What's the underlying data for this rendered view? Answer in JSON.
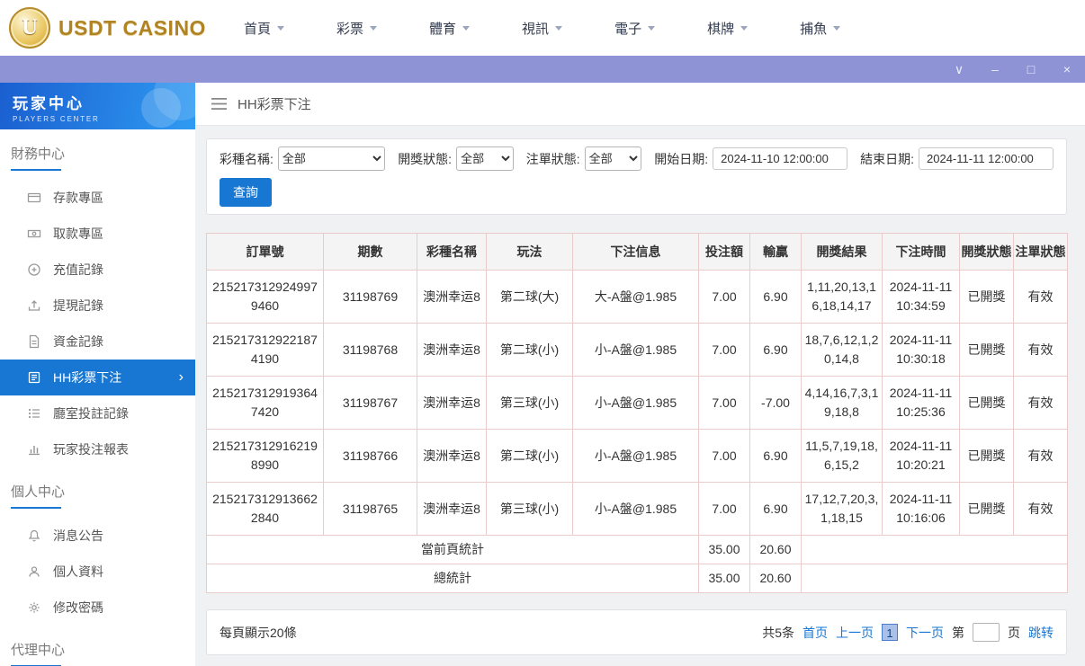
{
  "header": {
    "logo_badge": "U",
    "logo_text": "USDT CASINO",
    "nav": [
      {
        "label": "首頁"
      },
      {
        "label": "彩票"
      },
      {
        "label": "體育"
      },
      {
        "label": "視訊"
      },
      {
        "label": "電子"
      },
      {
        "label": "棋牌"
      },
      {
        "label": "捕魚"
      }
    ]
  },
  "titlebar": {
    "chevron": "∨",
    "minimize": "–",
    "maximize": "□",
    "close": "×"
  },
  "sidebar": {
    "title": "玩家中心",
    "subtitle": "PLAYERS CENTER",
    "active_chevron": "›",
    "sections": [
      {
        "heading": "財務中心",
        "items": [
          {
            "label": "存款專區",
            "icon": "deposit-card-icon"
          },
          {
            "label": "取款專區",
            "icon": "withdraw-cash-icon"
          },
          {
            "label": "充值記錄",
            "icon": "recharge-record-icon"
          },
          {
            "label": "提現記錄",
            "icon": "cashout-record-icon"
          },
          {
            "label": "資金記錄",
            "icon": "funds-record-icon"
          },
          {
            "label": "HH彩票下注",
            "icon": "lottery-bet-icon",
            "active": true
          },
          {
            "label": "廳室投註記錄",
            "icon": "room-bet-record-icon"
          },
          {
            "label": "玩家投注報表",
            "icon": "player-report-icon"
          }
        ]
      },
      {
        "heading": "個人中心",
        "items": [
          {
            "label": "消息公告",
            "icon": "bell-icon"
          },
          {
            "label": "個人資料",
            "icon": "user-icon"
          },
          {
            "label": "修改密碼",
            "icon": "gear-icon"
          }
        ]
      },
      {
        "heading": "代理中心",
        "items": []
      }
    ]
  },
  "breadcrumb": {
    "title": "HH彩票下注"
  },
  "filters": {
    "lottery": {
      "label": "彩種名稱:",
      "value": "全部"
    },
    "draw_status": {
      "label": "開獎狀態:",
      "value": "全部"
    },
    "order_status": {
      "label": "注單狀態:",
      "value": "全部"
    },
    "start_date": {
      "label": "開始日期:",
      "value": "2024-11-10 12:00:00"
    },
    "end_date": {
      "label": "結束日期:",
      "value": "2024-11-11 12:00:00"
    },
    "search_label": "查詢"
  },
  "table": {
    "headers": [
      "訂單號",
      "期數",
      "彩種名稱",
      "玩法",
      "下注信息",
      "投注額",
      "輸贏",
      "開獎結果",
      "下注時間",
      "開獎狀態",
      "注單狀態"
    ],
    "rows": [
      {
        "order": "2152173129249979460",
        "period": "31198769",
        "lottery": "澳洲幸运8",
        "play": "第二球(大)",
        "bet": "大-A盤@1.985",
        "amount": "7.00",
        "win": "6.90",
        "result": "1,11,20,13,16,18,14,17",
        "time": "2024-11-11 10:34:59",
        "draw_status": "已開獎",
        "order_status": "有效"
      },
      {
        "order": "2152173129221874190",
        "period": "31198768",
        "lottery": "澳洲幸运8",
        "play": "第二球(小)",
        "bet": "小-A盤@1.985",
        "amount": "7.00",
        "win": "6.90",
        "result": "18,7,6,12,1,20,14,8",
        "time": "2024-11-11 10:30:18",
        "draw_status": "已開獎",
        "order_status": "有效"
      },
      {
        "order": "2152173129193647420",
        "period": "31198767",
        "lottery": "澳洲幸运8",
        "play": "第三球(小)",
        "bet": "小-A盤@1.985",
        "amount": "7.00",
        "win": "-7.00",
        "result": "4,14,16,7,3,19,18,8",
        "time": "2024-11-11 10:25:36",
        "draw_status": "已開獎",
        "order_status": "有效"
      },
      {
        "order": "2152173129162198990",
        "period": "31198766",
        "lottery": "澳洲幸运8",
        "play": "第二球(小)",
        "bet": "小-A盤@1.985",
        "amount": "7.00",
        "win": "6.90",
        "result": "11,5,7,19,18,6,15,2",
        "time": "2024-11-11 10:20:21",
        "draw_status": "已開獎",
        "order_status": "有效"
      },
      {
        "order": "2152173129136622840",
        "period": "31198765",
        "lottery": "澳洲幸运8",
        "play": "第三球(小)",
        "bet": "小-A盤@1.985",
        "amount": "7.00",
        "win": "6.90",
        "result": "17,12,7,20,3,1,18,15",
        "time": "2024-11-11 10:16:06",
        "draw_status": "已開獎",
        "order_status": "有效"
      }
    ],
    "summary": [
      {
        "label": "當前頁統計",
        "amount": "35.00",
        "win": "20.60"
      },
      {
        "label": "總統計",
        "amount": "35.00",
        "win": "20.60"
      }
    ]
  },
  "pagination": {
    "page_size_text": "每頁顯示20條",
    "total_text": "共5条",
    "first": "首页",
    "prev": "上一页",
    "current_page": "1",
    "next": "下一页",
    "jump_before": "第",
    "jump_after": "页",
    "jump_button": "跳转"
  },
  "colors": {
    "accent_blue": "#1777d2",
    "titlebar_purple": "#8e93d6",
    "logo_gold": "#b08425",
    "table_border": "#e9cbcb"
  }
}
